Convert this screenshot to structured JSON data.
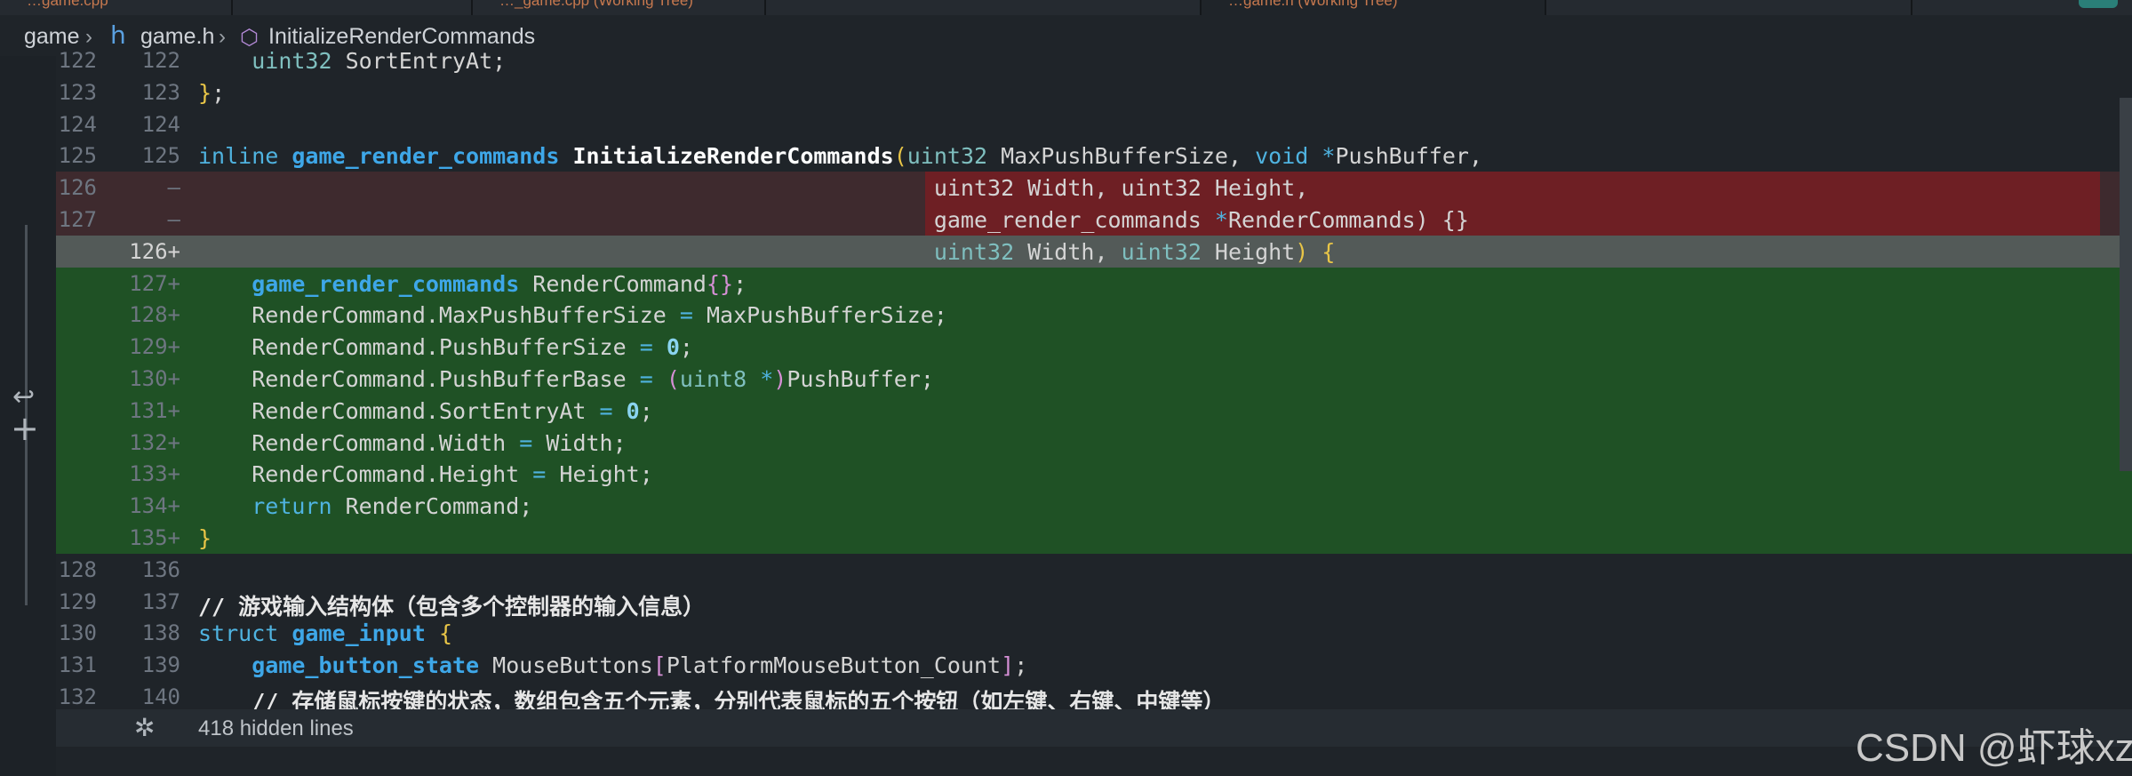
{
  "tabs": [
    {
      "label": "…game.cpp"
    },
    {
      "label": "…_game.cpp (Working Tree)"
    },
    {
      "label": "…game.h (Working Tree)"
    },
    {
      "label": "…"
    }
  ],
  "breadcrumb": {
    "folder": "game",
    "file": "game.h",
    "symbol": "InitializeRenderCommands"
  },
  "code_rows": [
    {
      "old": "122",
      "new": "122",
      "kind": "ctx",
      "segments": [
        [
          "    ",
          "pu"
        ],
        [
          "uint32",
          "tyn"
        ],
        [
          " SortEntryAt;",
          "pu"
        ]
      ]
    },
    {
      "old": "123",
      "new": "123",
      "kind": "ctx",
      "segments": [
        [
          "}",
          "br"
        ],
        [
          ";",
          "pu"
        ]
      ]
    },
    {
      "old": "124",
      "new": "124",
      "kind": "ctx",
      "segments": []
    },
    {
      "old": "125",
      "new": "125",
      "kind": "ctx",
      "segments": [
        [
          "inline ",
          "kw"
        ],
        [
          "game_render_commands",
          "ty"
        ],
        [
          " ",
          "pu"
        ],
        [
          "InitializeRenderCommands",
          "fn"
        ],
        [
          "(",
          "br"
        ],
        [
          "uint32",
          "tyn"
        ],
        [
          " MaxPushBufferSize, ",
          "pu"
        ],
        [
          "void",
          "kw"
        ],
        [
          " ",
          "pu"
        ],
        [
          "*",
          "op"
        ],
        [
          "PushBuffer,",
          "pu"
        ]
      ]
    },
    {
      "old": "126",
      "new": "—",
      "kind": "del",
      "segments": [
        [
          "                                                       uint32 Width, uint32 Height,",
          "pu"
        ]
      ]
    },
    {
      "old": "127",
      "new": "—",
      "kind": "del",
      "segments": [
        [
          "                                                       game_render_commands ",
          "pu"
        ],
        [
          "*",
          "op"
        ],
        [
          "RenderCommands) {}",
          "pu"
        ]
      ]
    },
    {
      "old": "",
      "new": "126+",
      "kind": "ins1",
      "segments": [
        [
          "                                                       ",
          "pu"
        ],
        [
          "uint32",
          "tyn"
        ],
        [
          " Width, ",
          "pu"
        ],
        [
          "uint32",
          "tyn"
        ],
        [
          " Height",
          "pu"
        ],
        [
          ") {",
          "br"
        ]
      ]
    },
    {
      "old": "",
      "new": "127+",
      "kind": "ins",
      "segments": [
        [
          "    ",
          "pu"
        ],
        [
          "game_render_commands",
          "ty"
        ],
        [
          " RenderCommand",
          "pu"
        ],
        [
          "{}",
          "pk"
        ],
        [
          ";",
          "pu"
        ]
      ]
    },
    {
      "old": "",
      "new": "128+",
      "kind": "ins",
      "segments": [
        [
          "    RenderCommand.MaxPushBufferSize ",
          "pu"
        ],
        [
          "=",
          "op"
        ],
        [
          " MaxPushBufferSize;",
          "pu"
        ]
      ]
    },
    {
      "old": "",
      "new": "129+",
      "kind": "ins",
      "segments": [
        [
          "    RenderCommand.PushBufferSize ",
          "pu"
        ],
        [
          "=",
          "op"
        ],
        [
          " ",
          "pu"
        ],
        [
          "0",
          "nm"
        ],
        [
          ";",
          "pu"
        ]
      ]
    },
    {
      "old": "",
      "new": "130+",
      "kind": "ins",
      "segments": [
        [
          "    RenderCommand.PushBufferBase ",
          "pu"
        ],
        [
          "=",
          "op"
        ],
        [
          " ",
          "pu"
        ],
        [
          "(",
          "pk"
        ],
        [
          "uint8",
          "tyn"
        ],
        [
          " ",
          "pu"
        ],
        [
          "*",
          "op"
        ],
        [
          ")",
          "pk"
        ],
        [
          "PushBuffer;",
          "pu"
        ]
      ]
    },
    {
      "old": "",
      "new": "131+",
      "kind": "ins",
      "segments": [
        [
          "    RenderCommand.SortEntryAt ",
          "pu"
        ],
        [
          "=",
          "op"
        ],
        [
          " ",
          "pu"
        ],
        [
          "0",
          "nm"
        ],
        [
          ";",
          "pu"
        ]
      ]
    },
    {
      "old": "",
      "new": "132+",
      "kind": "ins",
      "segments": [
        [
          "    RenderCommand.Width ",
          "pu"
        ],
        [
          "=",
          "op"
        ],
        [
          " Width;",
          "pu"
        ]
      ]
    },
    {
      "old": "",
      "new": "133+",
      "kind": "ins",
      "segments": [
        [
          "    RenderCommand.Height ",
          "pu"
        ],
        [
          "=",
          "op"
        ],
        [
          " Height;",
          "pu"
        ]
      ]
    },
    {
      "old": "",
      "new": "134+",
      "kind": "ins",
      "segments": [
        [
          "    ",
          "pu"
        ],
        [
          "return",
          "kw"
        ],
        [
          " RenderCommand;",
          "pu"
        ]
      ]
    },
    {
      "old": "",
      "new": "135+",
      "kind": "ins",
      "segments": [
        [
          "}",
          "br"
        ]
      ]
    },
    {
      "old": "128",
      "new": "136",
      "kind": "ctx",
      "segments": []
    },
    {
      "old": "129",
      "new": "137",
      "kind": "ctx",
      "segments": [
        [
          "// 游戏输入结构体（包含多个控制器的输入信息）",
          "cm"
        ]
      ]
    },
    {
      "old": "130",
      "new": "138",
      "kind": "ctx",
      "segments": [
        [
          "struct",
          "kw"
        ],
        [
          " ",
          "pu"
        ],
        [
          "game_input",
          "ty"
        ],
        [
          " {",
          "br"
        ]
      ]
    },
    {
      "old": "131",
      "new": "139",
      "kind": "ctx",
      "segments": [
        [
          "    ",
          "pu"
        ],
        [
          "game_button_state",
          "ty"
        ],
        [
          " MouseButtons",
          "pu"
        ],
        [
          "[",
          "pk"
        ],
        [
          "PlatformMouseButton_Count",
          "pu"
        ],
        [
          "]",
          "pk"
        ],
        [
          ";",
          "pu"
        ]
      ]
    },
    {
      "old": "132",
      "new": "140",
      "kind": "ctx",
      "segments": [
        [
          "    // 存储鼠标按键的状态，数组包含五个元素，分别代表鼠标的五个按钮（如左键、右键、中键等）",
          "cm"
        ]
      ]
    }
  ],
  "hidden_lines": "418 hidden lines",
  "watermark": "CSDN @虾球xz",
  "icons": {
    "revert": "revert-icon",
    "stage": "stage-plus-icon",
    "unfold": "unfold-icon",
    "header_file": "h-file-icon",
    "symbol": "cube-icon"
  }
}
